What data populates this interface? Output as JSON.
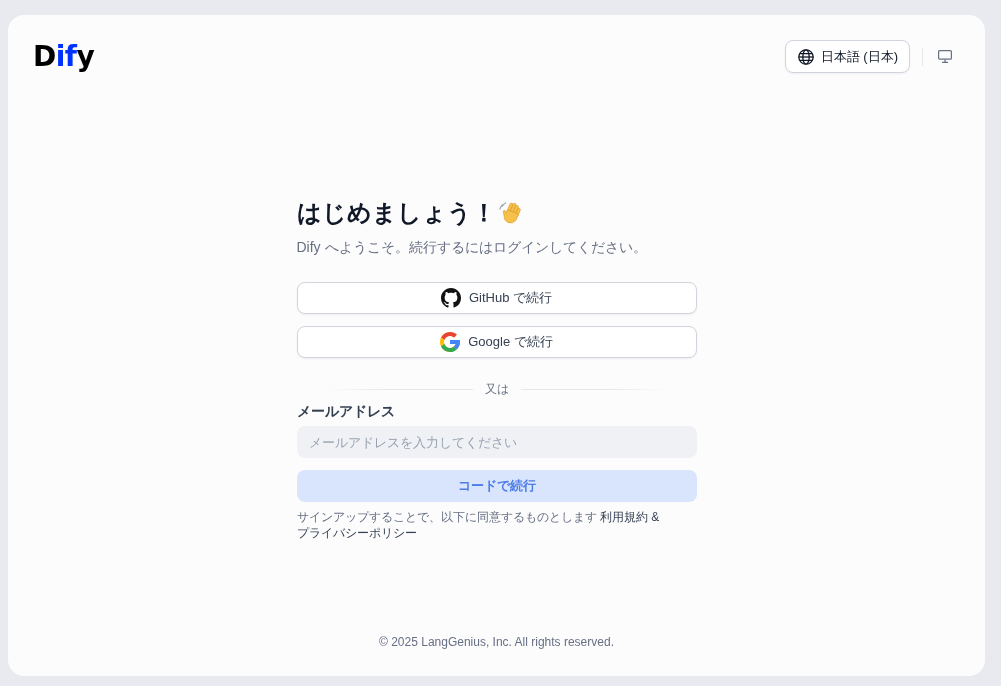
{
  "logo": {
    "parts": [
      {
        "text": "D",
        "color": "#000000"
      },
      {
        "text": "if",
        "color": "#0033ff"
      },
      {
        "text": "y",
        "color": "#000000"
      }
    ]
  },
  "header": {
    "language_button": {
      "label": "日本語 (日本)"
    }
  },
  "login": {
    "title": "はじめましょう！",
    "subtitle": "Dify へようこそ。続行するにはログインしてください。",
    "sso_buttons": [
      {
        "kind": "github",
        "label": "GitHub で続行"
      },
      {
        "kind": "google",
        "label": "Google で続行"
      }
    ],
    "divider_text": "又は",
    "email": {
      "label": "メールアドレス",
      "placeholder": "メールアドレスを入力してください"
    },
    "submit_button": {
      "label": "コードで続行",
      "disabled": true
    },
    "terms": {
      "text": "サインアップすることで、以下に同意するものとします",
      "terms_link": "利用規約",
      "separator": "&",
      "privacy_link": "プライバシーポリシー"
    }
  },
  "footer": "© 2025 LangGenius, Inc. All rights reserved."
}
